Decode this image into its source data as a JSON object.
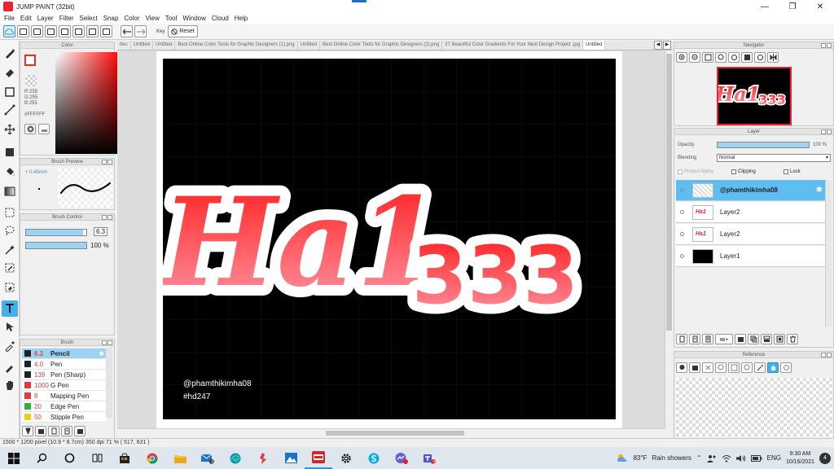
{
  "window": {
    "title": "JUMP PAINT (32bit)",
    "minimize": "—",
    "restore": "❐",
    "close": "✕"
  },
  "menu": [
    "File",
    "Edit",
    "Layer",
    "Filter",
    "Select",
    "Snap",
    "Color",
    "View",
    "Tool",
    "Window",
    "Cloud",
    "Help"
  ],
  "toolbar": {
    "key_label": "Key",
    "reset_label": "Reset"
  },
  "tabs": [
    "ttec",
    "Untitled",
    "Untitled",
    "Best Online Color Tools for Graphic Designers (1).png",
    "Untitled",
    "Best Online Color Tools for Graphic Designers (2).png",
    "27 Beautiful Color Gradients For Your Next Design Project .jpg",
    "Untitled"
  ],
  "color_panel": {
    "title": "Color",
    "r": "R:255",
    "g": "G:255",
    "b": "B:255",
    "hex": "#FFFFFF",
    "fg_color": "#ffffff",
    "accent": "#e0302a"
  },
  "brush_preview": {
    "title": "Brush Preview",
    "size_label": "+ 0.45mm"
  },
  "brush_control": {
    "title": "Brush Control",
    "size_value": "6.3",
    "opacity_value": "100 %",
    "size_fraction": 0.95,
    "opacity_fraction": 1.0
  },
  "brush_panel": {
    "title": "Brush",
    "items": [
      {
        "size": "6.3",
        "name": "Pencil",
        "chip": "#222222",
        "selected": true
      },
      {
        "size": "4.0",
        "name": "Pen",
        "chip": "#222222",
        "selected": false
      },
      {
        "size": "139",
        "name": "Pen (Sharp)",
        "chip": "#222222",
        "selected": false
      },
      {
        "size": "1000",
        "name": "G Pen",
        "chip": "#e03a3a",
        "selected": false
      },
      {
        "size": "8",
        "name": "Mapping Pen",
        "chip": "#e03a3a",
        "selected": false
      },
      {
        "size": "20",
        "name": "Edge Pen",
        "chip": "#2db040",
        "selected": false
      },
      {
        "size": "50",
        "name": "Stipple Pen",
        "chip": "#e8d21c",
        "selected": false
      }
    ]
  },
  "artwork": {
    "main_text": "Ha1",
    "secondary_text": "333",
    "credit_line1": "@phamthikimha08",
    "credit_line2": "#hd247",
    "fill_top": "#ff1a1a",
    "fill_bottom": "#ff9aa8",
    "outline": "#ffffff",
    "background": "#000000"
  },
  "status": {
    "text": "1500 * 1200 pixel   (10.9 * 8.7cm)   350 dpi   71 %   ( 517, 631 )"
  },
  "navigator": {
    "title": "Navigator"
  },
  "layer_panel": {
    "title": "Layer",
    "opacity_label": "Opacity",
    "opacity_value": "100 %",
    "opacity_fraction": 1.0,
    "blending_label": "Blending",
    "blending_value": "Normal",
    "protect_alpha": "Protect Alpha",
    "clipping": "Clipping",
    "lock": "Lock",
    "layers": [
      {
        "name": "@phamthikimha08",
        "selected": true,
        "thumb": "text"
      },
      {
        "name": "Layer2",
        "selected": false,
        "thumb": "art"
      },
      {
        "name": "Layer2",
        "selected": false,
        "thumb": "art"
      },
      {
        "name": "Layer1",
        "selected": false,
        "thumb": "black"
      }
    ]
  },
  "reference_panel": {
    "title": "Reference"
  },
  "taskbar": {
    "weather_temp": "83°F",
    "weather_desc": "Rain showers",
    "lang": "ENG",
    "time": "9:30 AM",
    "date": "10/16/2021",
    "mail_badge": "5",
    "teams_badge": "3",
    "notifications": "4"
  }
}
